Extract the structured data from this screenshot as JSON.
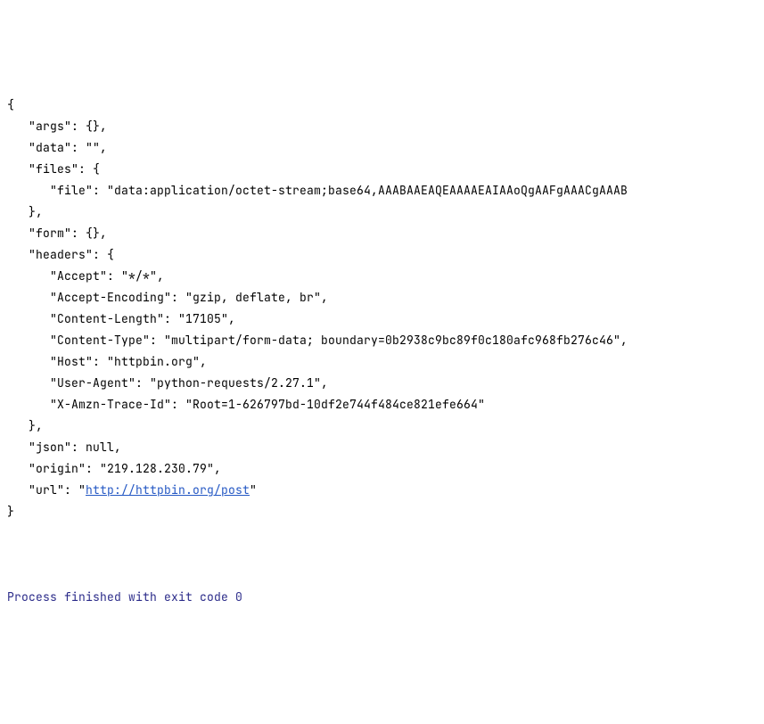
{
  "braces": {
    "open": "{",
    "close": "}"
  },
  "lines": {
    "args": "   \"args\": {},",
    "data": "   \"data\": \"\",",
    "files_open": "   \"files\": {",
    "file": "      \"file\": \"data:application/octet-stream;base64,AAABAAEAQEAAAAEAIAAoQgAAFgAAACgAAAB",
    "files_close": "   },",
    "form": "   \"form\": {},",
    "headers_open": "   \"headers\": {",
    "accept": "      \"Accept\": \"*/*\",",
    "accept_enc": "      \"Accept-Encoding\": \"gzip, deflate, br\",",
    "content_len": "      \"Content-Length\": \"17105\",",
    "content_type": "      \"Content-Type\": \"multipart/form-data; boundary=0b2938c9bc89f0c180afc968fb276c46\",",
    "host": "      \"Host\": \"httpbin.org\",",
    "user_agent": "      \"User-Agent\": \"python-requests/2.27.1\",",
    "trace_id": "      \"X-Amzn-Trace-Id\": \"Root=1-626797bd-10df2e744f484ce821efe664\"",
    "headers_close": "   },",
    "json": "   \"json\": null,",
    "origin": "   \"origin\": \"219.128.230.79\",",
    "url_prefix": "   \"url\": \"",
    "url_link": "http://httpbin.org/post",
    "url_suffix": "\""
  },
  "process_line": "Process finished with exit code 0"
}
